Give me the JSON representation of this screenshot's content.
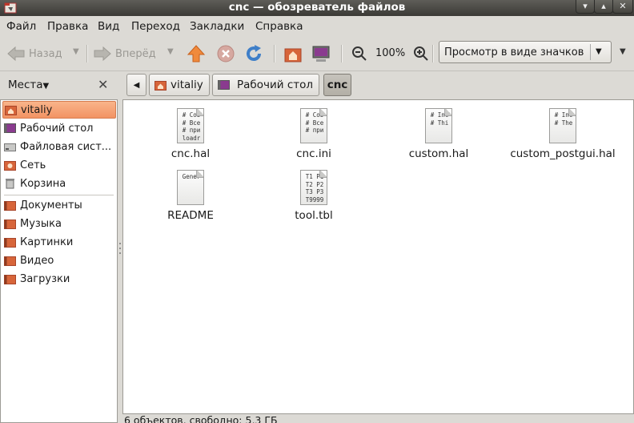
{
  "window": {
    "title": "cnc — обозреватель файлов",
    "controls": {
      "minimize": "▾",
      "maximize": "▴",
      "close": "✕"
    }
  },
  "menu": [
    "Файл",
    "Правка",
    "Вид",
    "Переход",
    "Закладки",
    "Справка"
  ],
  "toolbar": {
    "back_label": "Назад",
    "forward_label": "Вперёд",
    "zoom_value": "100%",
    "view_mode": "Просмотр в виде значков",
    "icons": [
      "back-arrow-icon",
      "forward-arrow-icon",
      "up-arrow-icon",
      "stop-icon",
      "reload-icon",
      "home-icon",
      "computer-icon",
      "zoom-out-icon",
      "zoom-in-icon"
    ]
  },
  "sidebar": {
    "header": "Места",
    "items": [
      {
        "label": "vitaliy",
        "icon": "home-folder-icon",
        "selected": true
      },
      {
        "label": "Рабочий стол",
        "icon": "desktop-icon"
      },
      {
        "label": "Файловая сист...",
        "icon": "drive-icon"
      },
      {
        "label": "Сеть",
        "icon": "network-icon"
      },
      {
        "label": "Корзина",
        "icon": "trash-icon"
      },
      {
        "label": "Документы",
        "icon": "folder-icon"
      },
      {
        "label": "Музыка",
        "icon": "folder-icon"
      },
      {
        "label": "Картинки",
        "icon": "folder-icon"
      },
      {
        "label": "Видео",
        "icon": "folder-icon"
      },
      {
        "label": "Загрузки",
        "icon": "folder-icon"
      }
    ]
  },
  "breadcrumbs": [
    "vitaliy",
    "Рабочий стол",
    "cnc"
  ],
  "files": [
    {
      "name": "cnc.hal",
      "preview": "# Соз\n# Все\n# при\nloadr"
    },
    {
      "name": "cnc.ini",
      "preview": "# Соз\n# Все\n# при"
    },
    {
      "name": "custom.hal",
      "preview": "# Inc\n# Thi"
    },
    {
      "name": "custom_postgui.hal",
      "preview": "# Inc\n# The"
    },
    {
      "name": "README",
      "preview": "Gener"
    },
    {
      "name": "tool.tbl",
      "preview": "T1 P1\nT2 P2\nT3 P3\nT9999"
    }
  ],
  "status": "6 объектов, свободно: 5,3 ГБ",
  "colors": {
    "selection": "#f29363",
    "titlebar": "#3b3a36",
    "folder": "#d7653a"
  }
}
